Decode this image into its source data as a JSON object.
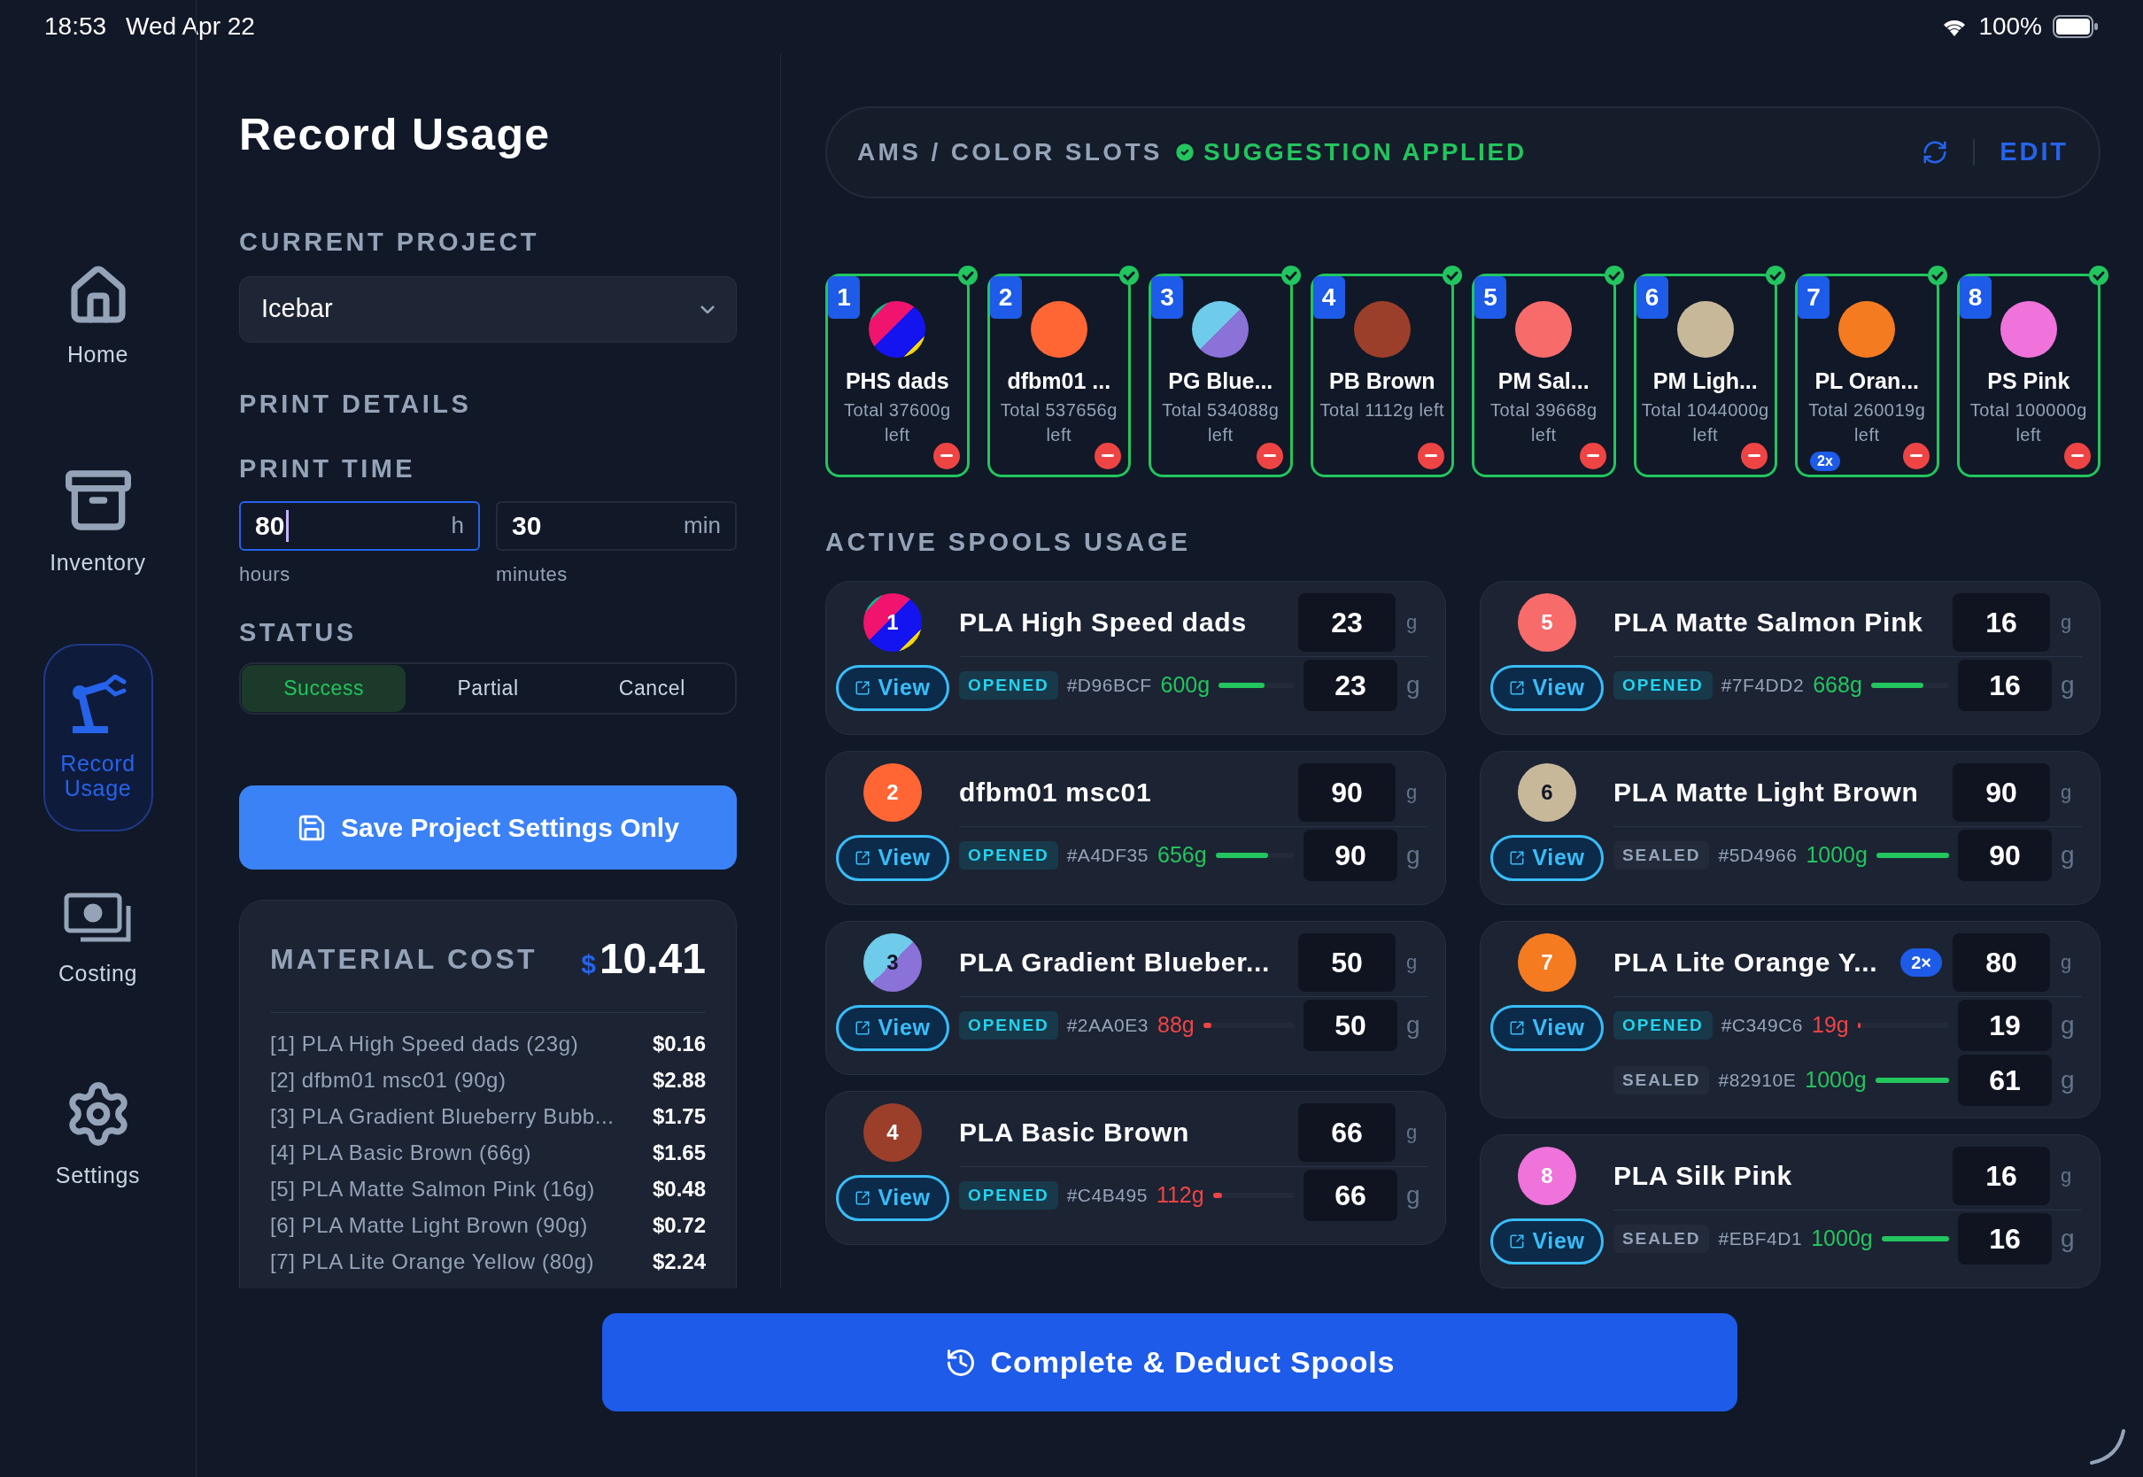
{
  "status_bar": {
    "time": "18:53",
    "date": "Wed Apr 22",
    "battery": "100%"
  },
  "nav": [
    {
      "kind": "home",
      "label": "Home",
      "selected": false
    },
    {
      "kind": "inventory",
      "label": "Inventory",
      "selected": false
    },
    {
      "kind": "record",
      "label": "Record Usage",
      "selected": true
    },
    {
      "kind": "costing",
      "label": "Costing",
      "selected": false
    },
    {
      "kind": "settings",
      "label": "Settings",
      "selected": false
    }
  ],
  "title": "Record Usage",
  "project": {
    "label": "CURRENT PROJECT",
    "value": "Icebar"
  },
  "print_details": {
    "label": "PRINT DETAILS",
    "time_label": "PRINT TIME",
    "fields": [
      {
        "value": "80",
        "unit": "h",
        "caption": "hours",
        "focused": true
      },
      {
        "value": "30",
        "unit": "min",
        "caption": "minutes",
        "focused": false
      }
    ]
  },
  "status": {
    "label": "STATUS",
    "options": [
      {
        "label": "Success",
        "selected": true
      },
      {
        "label": "Partial",
        "selected": false
      },
      {
        "label": "Cancel",
        "selected": false
      }
    ]
  },
  "save_button": "Save Project Settings Only",
  "material_cost": {
    "label": "MATERIAL COST",
    "currency": "$",
    "total": "10.41",
    "rows": [
      {
        "label": "[1] PLA High Speed dads (23g)",
        "amount": "$0.16"
      },
      {
        "label": "[2] dfbm01 msc01 (90g)",
        "amount": "$2.88"
      },
      {
        "label": "[3] PLA Gradient Blueberry Bubb...",
        "amount": "$1.75"
      },
      {
        "label": "[4] PLA Basic Brown (66g)",
        "amount": "$1.65"
      },
      {
        "label": "[5] PLA Matte Salmon Pink (16g)",
        "amount": "$0.48"
      },
      {
        "label": "[6] PLA Matte Light Brown (90g)",
        "amount": "$0.72"
      },
      {
        "label": "[7] PLA Lite Orange Yellow (80g)",
        "amount": "$2.24"
      }
    ]
  },
  "ams": {
    "title": "AMS / COLOR SLOTS",
    "status": "SUGGESTION APPLIED",
    "edit": "EDIT"
  },
  "slots": [
    {
      "number": "1",
      "name": "PHS dads",
      "total": "Total 37600g left",
      "kind": "multicolor",
      "color": "#1414f0"
    },
    {
      "number": "2",
      "name": "dfbm01 ...",
      "total": "Total 537656g left",
      "kind": "solid",
      "color": "#ff6633"
    },
    {
      "number": "3",
      "name": "PG Blue...",
      "total": "Total 534088g left",
      "kind": "gradient",
      "color": "#6ecbea"
    },
    {
      "number": "4",
      "name": "PB Brown",
      "total": "Total 1112g left",
      "kind": "solid",
      "color": "#9b3f2a"
    },
    {
      "number": "5",
      "name": "PM Sal...",
      "total": "Total 39668g left",
      "kind": "solid",
      "color": "#f76b6b"
    },
    {
      "number": "6",
      "name": "PM Ligh...",
      "total": "Total 1044000g left",
      "kind": "solid",
      "color": "#c8b89a"
    },
    {
      "number": "7",
      "name": "PL Oran...",
      "total": "Total 260019g left",
      "badge": "2x",
      "kind": "solid",
      "color": "#f47b20"
    },
    {
      "number": "8",
      "name": "PS Pink",
      "total": "Total 100000g left",
      "kind": "solid",
      "color": "#ef73da"
    }
  ],
  "usage_label": "ACTIVE SPOOLS USAGE",
  "spools": [
    {
      "slot": "1",
      "name": "PLA High Speed dads",
      "qty": "23",
      "unit": "g",
      "view": "View",
      "kind": "multicolor",
      "color": "#1414f0",
      "lots": [
        {
          "status": "OPENED",
          "sealed": false,
          "hex": "#D96BCF",
          "remaining": "600g",
          "low": false,
          "level": 0.6,
          "qty": "23",
          "unit": "g"
        }
      ]
    },
    {
      "slot": "2",
      "name": "dfbm01 msc01",
      "qty": "90",
      "unit": "g",
      "view": "View",
      "kind": "solid",
      "color": "#ff6633",
      "lots": [
        {
          "status": "OPENED",
          "sealed": false,
          "hex": "#A4DF35",
          "remaining": "656g",
          "low": false,
          "level": 0.66,
          "qty": "90",
          "unit": "g"
        }
      ]
    },
    {
      "slot": "3",
      "name": "PLA Gradient Blueber...",
      "qty": "50",
      "unit": "g",
      "view": "View",
      "kind": "gradient",
      "color": "#6ecbea",
      "lots": [
        {
          "status": "OPENED",
          "sealed": false,
          "hex": "#2AA0E3",
          "remaining": "88g",
          "low": true,
          "level": 0.09,
          "qty": "50",
          "unit": "g"
        }
      ]
    },
    {
      "slot": "4",
      "name": "PLA Basic Brown",
      "qty": "66",
      "unit": "g",
      "view": "View",
      "kind": "solid",
      "color": "#9b3f2a",
      "lots": [
        {
          "status": "OPENED",
          "sealed": false,
          "hex": "#C4B495",
          "remaining": "112g",
          "low": true,
          "level": 0.11,
          "qty": "66",
          "unit": "g"
        }
      ]
    },
    {
      "slot": "5",
      "name": "PLA Matte Salmon Pink",
      "qty": "16",
      "unit": "g",
      "view": "View",
      "kind": "solid",
      "color": "#f76b6b",
      "lots": [
        {
          "status": "OPENED",
          "sealed": false,
          "hex": "#7F4DD2",
          "remaining": "668g",
          "low": false,
          "level": 0.67,
          "qty": "16",
          "unit": "g"
        }
      ]
    },
    {
      "slot": "6",
      "name": "PLA Matte Light Brown",
      "qty": "90",
      "unit": "g",
      "view": "View",
      "kind": "solid",
      "color": "#c8b89a",
      "lots": [
        {
          "status": "SEALED",
          "sealed": true,
          "hex": "#5D4966",
          "remaining": "1000g",
          "low": false,
          "level": 1,
          "qty": "90",
          "unit": "g"
        }
      ]
    },
    {
      "slot": "7",
      "name": "PLA Lite Orange Y...",
      "badge": "2×",
      "qty": "80",
      "unit": "g",
      "view": "View",
      "kind": "solid",
      "color": "#f47b20",
      "lots": [
        {
          "status": "OPENED",
          "sealed": false,
          "hex": "#C349C6",
          "remaining": "19g",
          "low": true,
          "level": 0.02,
          "qty": "19",
          "unit": "g"
        },
        {
          "status": "SEALED",
          "sealed": true,
          "hex": "#82910E",
          "remaining": "1000g",
          "low": false,
          "level": 1,
          "qty": "61",
          "unit": "g"
        }
      ]
    },
    {
      "slot": "8",
      "name": "PLA Silk Pink",
      "qty": "16",
      "unit": "g",
      "view": "View",
      "kind": "solid",
      "color": "#ef73da",
      "lots": [
        {
          "status": "SEALED",
          "sealed": true,
          "hex": "#EBF4D1",
          "remaining": "1000g",
          "low": false,
          "level": 1,
          "qty": "16",
          "unit": "g"
        }
      ]
    }
  ],
  "complete_button": "Complete & Deduct Spools"
}
